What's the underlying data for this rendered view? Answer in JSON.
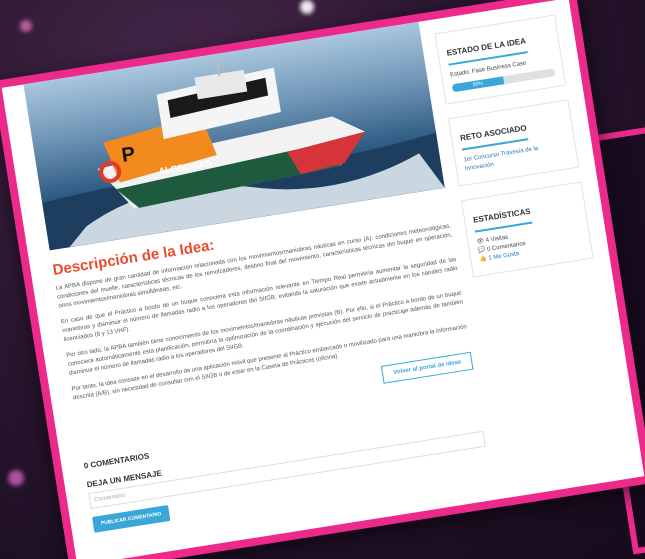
{
  "description": {
    "title": "Descripción de la Idea:",
    "paragraphs": [
      "La APBA dispone de gran cantidad de información relacionada con los movimientos/maniobras náuticas en curso (A): condiciones meteorológicas, condiciones del muelle, características técnicas de los remolcadores, destino final del movimiento, características técnicas del buque en operación, otros movimientos/maniobras simultáneas, etc.",
      "En caso de que el Práctico a bordo de un buque conociera esta información relevante en Tiempo Real permitiría aumentar la seguridad de las maniobras y disminuir el número de llamadas radio a los operadores del SIIGB, evitando la saturación que existe actualmente en los canales radio licenciados (8 y 13 VHF).",
      "Por otro lado, la APBA también tiene conocimiento de los movimientos/maniobras náuticas previstas (B). Por ello, si el Práctico a bordo de un buque conociera automáticamente esta planificación, permitiría la optimización de la coordinación y ejecución del servicio de practicaje además de también disminuir el número de llamadas radio a los operadores del SIIGB.",
      "Por tanto, la idea consiste en el desarrollo de una aplicación móvil que presente al Práctico embarcado o movilizado para una maniobra la información descrita (A/B), sin necesidad de consultar con el SIIGB o de estar en la Caseta de Prácticos (oficina)."
    ],
    "back_button": "Volver al portal de ideas"
  },
  "boat": {
    "hull_letter": "P",
    "name": "ALGECIRAS"
  },
  "comments": {
    "count_title": "0 COMENTARIOS",
    "leave_message": "DEJA UN MENSAJE",
    "placeholder": "Comentario",
    "submit": "PUBLICAR COMENTARIO"
  },
  "sidebar": {
    "state": {
      "title": "ESTADO DE LA IDEA",
      "status": "Estado: Fase Business Case",
      "progress_label": "50%",
      "progress": 0.5
    },
    "challenge": {
      "title": "RETO ASOCIADO",
      "link": "1er Concurso Travesía de la Innovación"
    },
    "stats": {
      "title": "ESTADÍSTICAS",
      "visits": "4 Visitas",
      "comments": "0 Comentarios",
      "likes": "1 Me Gusta"
    }
  },
  "colors": {
    "frame": "#ec2a8c",
    "accent": "#3aa7d9",
    "title": "#ec4a2c"
  }
}
